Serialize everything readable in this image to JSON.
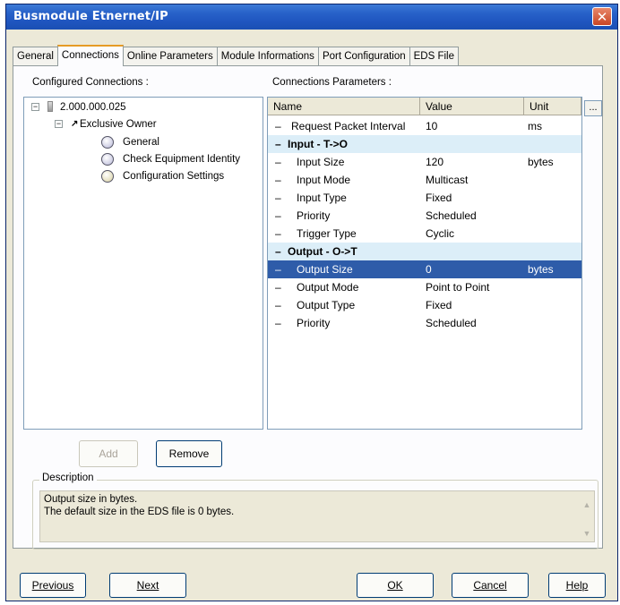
{
  "window": {
    "title": "Busmodule Etnernet/IP",
    "close_glyph": "✕"
  },
  "tabs": [
    {
      "label": "General",
      "active": false
    },
    {
      "label": "Connections",
      "active": true
    },
    {
      "label": "Online Parameters",
      "active": false
    },
    {
      "label": "Module Informations",
      "active": false
    },
    {
      "label": "Port Configuration",
      "active": false
    },
    {
      "label": "EDS File",
      "active": false
    }
  ],
  "configured": {
    "label": "Configured Connections :",
    "tree": {
      "root": "2.000.000.025",
      "owner": "Exclusive Owner",
      "children": [
        "General",
        "Check Equipment Identity",
        "Configuration Settings"
      ]
    }
  },
  "params": {
    "label": "Connections Parameters :",
    "headers": {
      "name": "Name",
      "value": "Value",
      "unit": "Unit"
    },
    "ellipsis": "...",
    "rows": [
      {
        "name": "Request Packet Interval",
        "value": "10",
        "unit": "ms"
      },
      {
        "name": "Input - T->O",
        "value": "",
        "unit": ""
      },
      {
        "name": "Input Size",
        "value": "120",
        "unit": "bytes"
      },
      {
        "name": "Input Mode",
        "value": "Multicast",
        "unit": ""
      },
      {
        "name": "Input Type",
        "value": "Fixed",
        "unit": ""
      },
      {
        "name": "Priority",
        "value": "Scheduled",
        "unit": ""
      },
      {
        "name": "Trigger Type",
        "value": "Cyclic",
        "unit": ""
      },
      {
        "name": "Output - O->T",
        "value": "",
        "unit": ""
      },
      {
        "name": "Output Size",
        "value": "0",
        "unit": "bytes"
      },
      {
        "name": "Output Mode",
        "value": "Point to Point",
        "unit": ""
      },
      {
        "name": "Output Type",
        "value": "Fixed",
        "unit": ""
      },
      {
        "name": "Priority",
        "value": "Scheduled",
        "unit": ""
      }
    ]
  },
  "buttons": {
    "add": "Add",
    "remove": "Remove",
    "previous": "Previous",
    "next": "Next",
    "ok": "OK",
    "cancel": "Cancel",
    "help": "Help"
  },
  "description": {
    "title": "Description",
    "line1": "Output size in bytes.",
    "line2": "The default size in the EDS file is 0 bytes."
  },
  "colors": {
    "titlebar": "#2761c9",
    "selection": "#2e5ca9",
    "group_row": "#dceef8",
    "active_tab_accent": "#e69b26"
  }
}
